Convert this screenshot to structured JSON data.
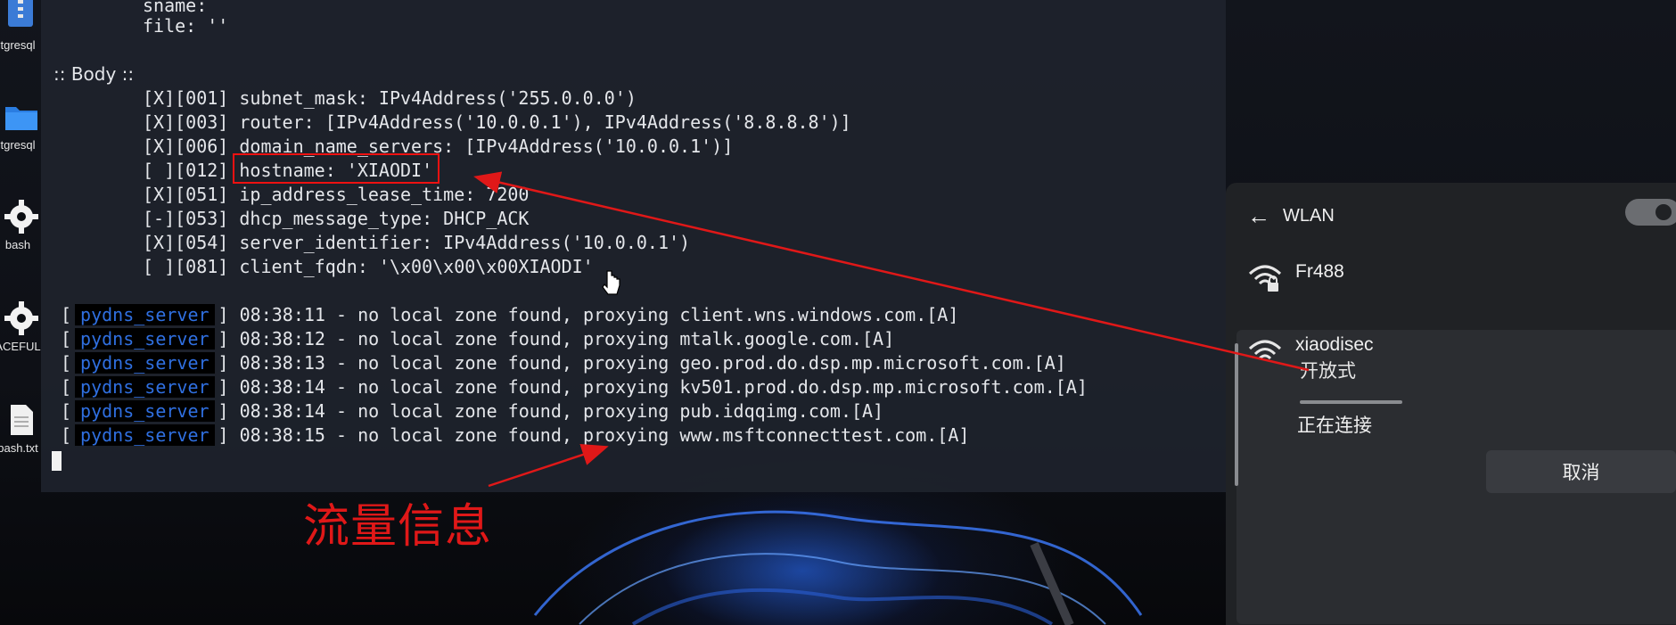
{
  "desktop": {
    "icons": [
      {
        "label": "tgresql",
        "icon": "archive-file-icon"
      },
      {
        "label": "tgresql",
        "icon": "folder-icon"
      },
      {
        "label": "bash",
        "icon": "gear-icon"
      },
      {
        "label": "ACEFUL",
        "icon": "gear-icon"
      },
      {
        "label": "bash.txt",
        "icon": "text-file-icon"
      }
    ]
  },
  "terminal": {
    "top_lines": [
      "sname: ",
      "file: ''"
    ],
    "section_header": ":: Body ::",
    "body_lines": [
      "[X][001] subnet_mask: IPv4Address('255.0.0.0')",
      "[X][003] router: [IPv4Address('10.0.0.1'), IPv4Address('8.8.8.8')]",
      "[X][006] domain_name_servers: [IPv4Address('10.0.0.1')]",
      "[ ][012] hostname: 'XIAODI'",
      "[X][051] ip_address_lease_time: 7200",
      "[-][053] dhcp_message_type: DHCP_ACK",
      "[X][054] server_identifier: IPv4Address('10.0.0.1')",
      "[ ][081] client_fqdn: '\\x00\\x00\\x00XIAODI'"
    ],
    "log_tag": "pydns_server",
    "log_lines": [
      {
        "time": "08:38:11",
        "msg": " - no local zone found, proxying client.wns.windows.com.[A]"
      },
      {
        "time": "08:38:12",
        "msg": " - no local zone found, proxying mtalk.google.com.[A]"
      },
      {
        "time": "08:38:13",
        "msg": " - no local zone found, proxying geo.prod.do.dsp.mp.microsoft.com.[A]"
      },
      {
        "time": "08:38:14",
        "msg": " - no local zone found, proxying kv501.prod.do.dsp.mp.microsoft.com.[A]"
      },
      {
        "time": "08:38:14",
        "msg": " - no local zone found, proxying pub.idqqimg.com.[A]"
      },
      {
        "time": "08:38:15",
        "msg": " - no local zone found, proxying www.msftconnecttest.com.[A]"
      }
    ]
  },
  "annotation": {
    "text": "流量信息",
    "color": "#e01818"
  },
  "wlan": {
    "title": "WLAN",
    "toggle_on": true,
    "networks": [
      {
        "name": "Fr488",
        "secured": true
      },
      {
        "name": "xiaodisec",
        "secured": false,
        "security_label": "开放式",
        "status": "正在连接"
      }
    ],
    "cancel_label": "取消"
  }
}
